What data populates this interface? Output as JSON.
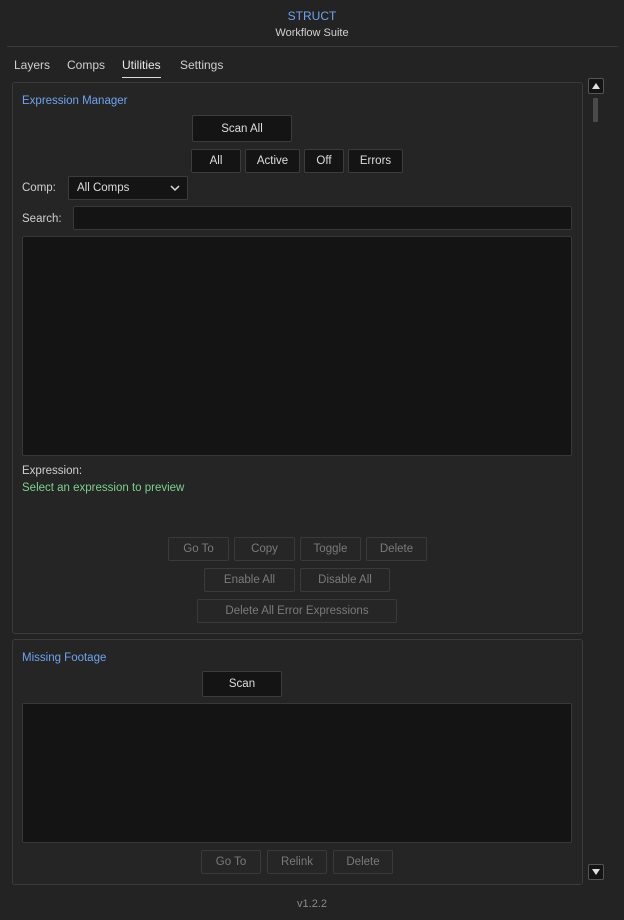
{
  "header": {
    "title": "STRUCT",
    "subtitle": "Workflow Suite"
  },
  "tabs": [
    {
      "label": "Layers"
    },
    {
      "label": "Comps"
    },
    {
      "label": "Utilities",
      "active": true
    },
    {
      "label": "Settings"
    }
  ],
  "expression_manager": {
    "title": "Expression Manager",
    "scan_all_label": "Scan All",
    "filters": [
      "All",
      "Active",
      "Off",
      "Errors"
    ],
    "comp_label": "Comp:",
    "comp_selected": "All Comps",
    "search_label": "Search:",
    "search_value": "",
    "search_placeholder": "",
    "expression_label": "Expression:",
    "preview_text": "Select an expression to preview",
    "actions": [
      "Go To",
      "Copy",
      "Toggle",
      "Delete"
    ],
    "bulk_actions": [
      "Enable All",
      "Disable All"
    ],
    "delete_errors_label": "Delete All Error Expressions"
  },
  "missing_footage": {
    "title": "Missing Footage",
    "scan_label": "Scan",
    "actions": [
      "Go To",
      "Relink",
      "Delete"
    ]
  },
  "version": "v1.2.2",
  "colors": {
    "accent": "#6fa3ef",
    "preview": "#7fcf8e",
    "background": "#232323",
    "field": "#141414"
  }
}
